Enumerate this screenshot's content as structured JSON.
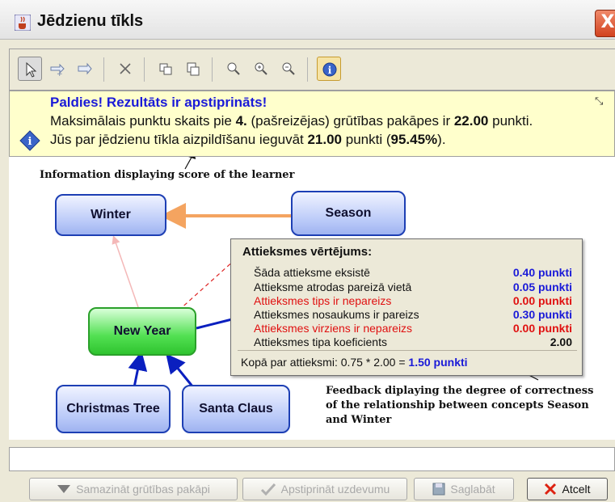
{
  "window": {
    "title": "Jēdzienu tīkls",
    "close_label": "X"
  },
  "toolbar": {
    "buttons": [
      "select-icon",
      "add-relation-icon",
      "relation-icon",
      "delete-icon",
      "copy-icon",
      "paste-icon",
      "zoom-icon",
      "zoom-in-icon",
      "zoom-out-icon",
      "info-icon"
    ]
  },
  "message": {
    "line1": "Paldies! Rezultāts ir apstiprināts!",
    "line2_pre": "Maksimālais punktu skaits pie ",
    "line2_level": "4.",
    "line2_mid": " (pašreizējas) grūtības pakāpes ir ",
    "line2_points": "22.00",
    "line2_post": " punkti.",
    "line3_pre": "Jūs par jēdzienu tīkla aizpildīšanu ieguvāt ",
    "line3_points": "21.00",
    "line3_mid": " punkti (",
    "line3_percent": "95.45%",
    "line3_post": ")."
  },
  "annotations": {
    "score_caption": "Information displaying score of the learner",
    "feedback_caption_1": "Feedback diplaying the degree of correctness",
    "feedback_caption_2": "of the relationship between concepts Season",
    "feedback_caption_3": "and Winter"
  },
  "concepts": {
    "winter": "Winter",
    "season": "Season",
    "new_year": "New Year",
    "christmas_tree": "Christmas Tree",
    "santa_claus": "Santa Claus"
  },
  "evaluation": {
    "title": "Attieksmes vērtējums:",
    "rows": [
      {
        "label": "Šāda attieksme eksistē",
        "value": "0.40 punkti",
        "color": "#1a1ad8",
        "label_color": "#111111"
      },
      {
        "label": "Attieksme atrodas pareizā vietā",
        "value": "0.05 punkti",
        "color": "#1a1ad8",
        "label_color": "#111111"
      },
      {
        "label": "Attieksmes tips ir nepareizs",
        "value": "0.00 punkti",
        "color": "#e01010",
        "label_color": "#e01010"
      },
      {
        "label": "Attieksmes nosaukums ir pareizs",
        "value": "0.30 punkti",
        "color": "#1a1ad8",
        "label_color": "#111111"
      },
      {
        "label": "Attieksmes virziens ir nepareizs",
        "value": "0.00 punkti",
        "color": "#e01010",
        "label_color": "#e01010"
      },
      {
        "label": "Attieksmes tipa koeficients",
        "value": "2.00",
        "color": "#111111",
        "label_color": "#111111"
      }
    ],
    "total_label": "Kopā par attieksmi: 0.75 * 2.00 = ",
    "total_value": "1.50 punkti"
  },
  "buttons": {
    "decrease": "Samazināt grūtības pakāpi",
    "confirm": "Apstiprināt uzdevumu",
    "save": "Saglabāt",
    "cancel": "Atcelt"
  },
  "colors": {
    "accent_blue": "#1a1ad8",
    "error_red": "#e01010",
    "node_blue": "#b8c8f8",
    "node_green": "#52e052",
    "arrow_orange": "#f4a460"
  }
}
